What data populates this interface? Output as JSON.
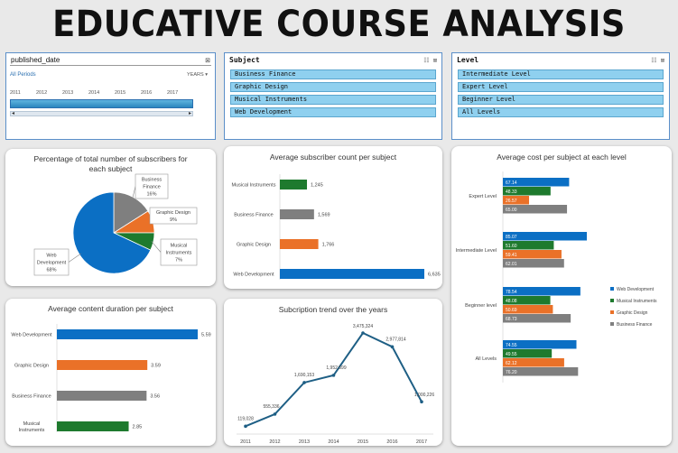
{
  "title": "EDUCATIVE COURSE ANALYSIS",
  "timeline": {
    "header": "published_date",
    "period_label": "All Periods",
    "unit_label": "YEARS",
    "years": [
      "2011",
      "2012",
      "2013",
      "2014",
      "2015",
      "2016",
      "2017"
    ]
  },
  "subject_slicer": {
    "header": "Subject",
    "items": [
      "Business Finance",
      "Graphic Design",
      "Musical Instruments",
      "Web Development"
    ]
  },
  "level_slicer": {
    "header": "Level",
    "items": [
      "Intermediate Level",
      "Expert Level",
      "Beginner Level",
      "All Levels"
    ]
  },
  "colors": {
    "web": "#0b6fc4",
    "music": "#1e7a2e",
    "graphic": "#ea7128",
    "business": "#7f7f7f",
    "line": "#1e5f85"
  },
  "chart_data": [
    {
      "id": "pie",
      "type": "pie",
      "title": "Percentage of total number of subscribers for each subject",
      "labels": [
        [
          "Business",
          "Finance",
          "16%"
        ],
        [
          "Graphic Design",
          "9%"
        ],
        [
          "Musical",
          "Instruments",
          "7%"
        ],
        [
          "Web",
          "Development",
          "68%"
        ]
      ],
      "values": [
        16,
        9,
        7,
        68
      ]
    },
    {
      "id": "subscribers",
      "type": "bar",
      "title": "Average subscriber count per subject",
      "categories": [
        "Musical Instruments",
        "Business Finance",
        "Graphic Design",
        "Web Development"
      ],
      "values": [
        1245,
        1569,
        1766,
        6635
      ],
      "labels": [
        "1,245",
        "1,569",
        "1,766",
        "6,635"
      ]
    },
    {
      "id": "cost",
      "type": "bar",
      "title": "Average cost per subject at each level",
      "categories": [
        "Expert Level",
        "Intermediate Level",
        "Beginner level",
        "All Levels"
      ],
      "values": [
        [
          67.14,
          48.33,
          26.57,
          65.0
        ],
        [
          85.07,
          51.6,
          59.41,
          62.01
        ],
        [
          78.54,
          48.08,
          50.69,
          68.73
        ],
        [
          74.55,
          49.55,
          62.12,
          76.2
        ]
      ],
      "labels": [
        [
          "67.14",
          "48.33",
          "26.57",
          "65.00"
        ],
        [
          "85.07",
          "51.60",
          "59.41",
          "62.01"
        ],
        [
          "78.54",
          "48.08",
          "50.69",
          "68.73"
        ],
        [
          "74.55",
          "49.55",
          "62.12",
          "76.20"
        ]
      ],
      "legend": [
        "Web Development",
        "Musical Instruments",
        "Graphic Design",
        "Business Finance"
      ]
    },
    {
      "id": "duration",
      "type": "bar",
      "title": "Average content duration per subject",
      "categories": [
        [
          "Web Development"
        ],
        [
          "Graphic Design"
        ],
        [
          "Business Finance"
        ],
        [
          "Musical",
          "Instruments"
        ]
      ],
      "values": [
        5.59,
        3.59,
        3.56,
        2.85
      ],
      "labels": [
        "5.59",
        "3.59",
        "3.56",
        "2.85"
      ]
    },
    {
      "id": "trend",
      "type": "line",
      "title": "Subcription trend over the years",
      "x": [
        "2011",
        "2012",
        "2013",
        "2014",
        "2015",
        "2016",
        "2017"
      ],
      "y": [
        119028,
        555336,
        1690153,
        1952599,
        3475324,
        2977814,
        1000226
      ],
      "labels": [
        "119,028",
        "555,336",
        "1,690,153",
        "1,952,599",
        "3,475,324",
        "2,977,814",
        "1,000,226"
      ]
    }
  ]
}
